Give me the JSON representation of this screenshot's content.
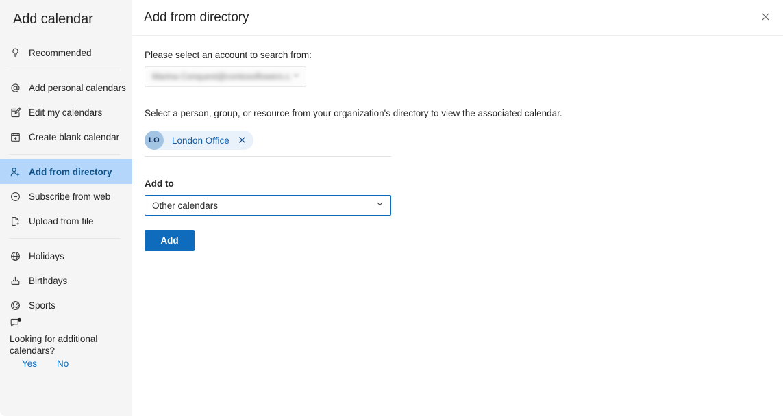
{
  "sidebar": {
    "title": "Add calendar",
    "groups": [
      {
        "items": [
          {
            "label": "Recommended",
            "icon": "lightbulb-icon",
            "name": "recommended",
            "selected": false
          }
        ]
      },
      {
        "items": [
          {
            "label": "Add personal calendars",
            "icon": "at-sign-icon",
            "name": "add-personal-calendars",
            "selected": false
          },
          {
            "label": "Edit my calendars",
            "icon": "edit-pencil-icon",
            "name": "edit-my-calendars",
            "selected": false
          },
          {
            "label": "Create blank calendar",
            "icon": "calendar-plus-icon",
            "name": "create-blank-calendar",
            "selected": false
          }
        ]
      },
      {
        "items": [
          {
            "label": "Add from directory",
            "icon": "person-add-icon",
            "name": "add-from-directory",
            "selected": true
          },
          {
            "label": "Subscribe from web",
            "icon": "circle-minus-icon",
            "name": "subscribe-from-web",
            "selected": false
          },
          {
            "label": "Upload from file",
            "icon": "file-plus-icon",
            "name": "upload-from-file",
            "selected": false
          }
        ]
      },
      {
        "items": [
          {
            "label": "Holidays",
            "icon": "globe-icon",
            "name": "holidays",
            "selected": false
          },
          {
            "label": "Birthdays",
            "icon": "birthday-cake-icon",
            "name": "birthdays",
            "selected": false
          },
          {
            "label": "Sports",
            "icon": "sports-ball-icon",
            "name": "sports",
            "selected": false
          }
        ]
      }
    ],
    "feedback": {
      "icon": "feedback-bubble-icon",
      "question": "Looking for additional calendars?",
      "yes_label": "Yes",
      "no_label": "No"
    }
  },
  "main": {
    "title": "Add from directory",
    "close_icon": "close-icon",
    "account_label": "Please select an account to search from:",
    "account_value": "Marina Conquest@contosoflowers.c…",
    "account_redacted": true,
    "helper_text": "Select a person, group, or resource from your organization's directory to view the associated calendar.",
    "picker": {
      "chip": {
        "initials": "LO",
        "name": "London Office",
        "remove_icon": "close-icon"
      }
    },
    "addto_label": "Add to",
    "addto_value": "Other calendars",
    "addto_options": [
      "Other calendars"
    ],
    "add_button": "Add"
  },
  "colors": {
    "accent": "#0f6cbd",
    "selected_bg": "#b4d6fa",
    "selected_text": "#0f548c",
    "sidebar_bg": "#f5f5f5",
    "chip_bg": "#e9f1fa",
    "chip_avatar": "#a3c4e3",
    "text": "#242424"
  }
}
